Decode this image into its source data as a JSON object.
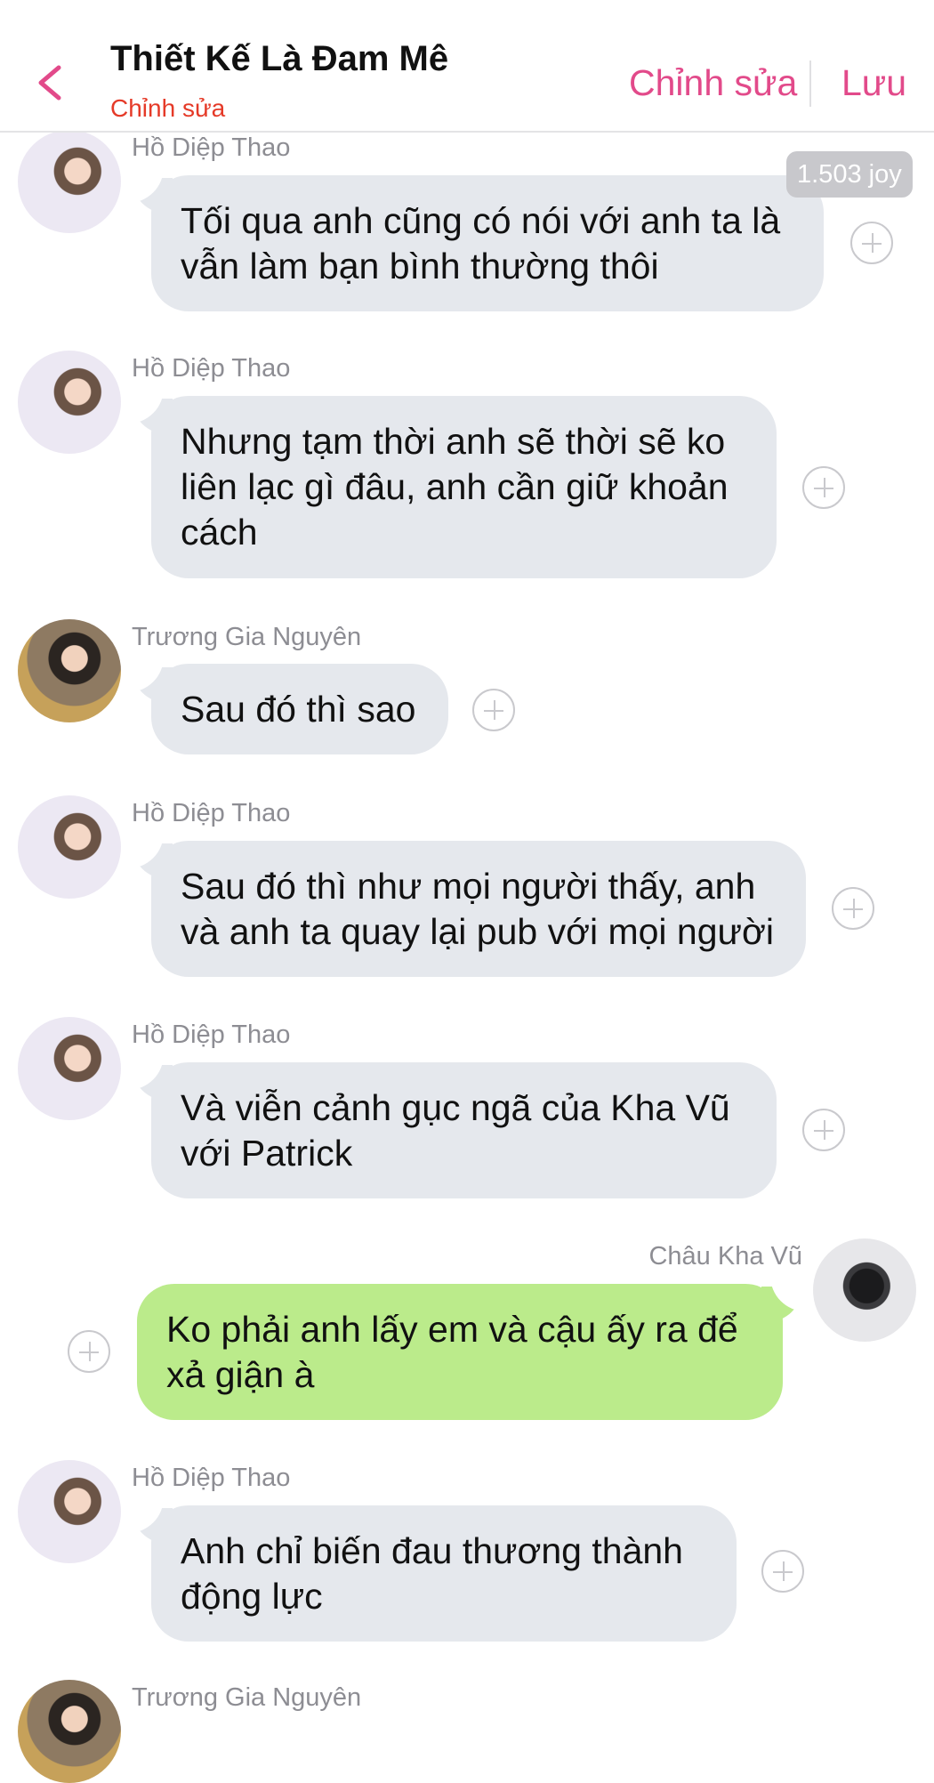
{
  "header": {
    "title": "Thiết Kế Là Đam Mê",
    "subtitle": "Chỉnh sửa",
    "edit_label": "Chỉnh sửa",
    "save_label": "Lưu",
    "accent_color": "#e24a8a"
  },
  "joy_badge": "1.503 joy",
  "messages": [
    {
      "sender": "Hồ Diệp Thao",
      "text": "Tối qua anh cũng có nói với anh ta là\nvẫn làm bạn bình thường thôi",
      "direction": "incoming"
    },
    {
      "sender": "Hồ Diệp Thao",
      "text": "Nhưng tạm thời anh sẽ thời sẽ ko\nliên lạc gì đâu, anh cần giữ khoản\ncách",
      "direction": "incoming"
    },
    {
      "sender": "Trương Gia Nguyên",
      "text": "Sau đó thì sao",
      "direction": "incoming"
    },
    {
      "sender": "Hồ Diệp Thao",
      "text": "Sau đó thì như mọi người thấy, anh\nvà anh ta quay lại pub với mọi người",
      "direction": "incoming"
    },
    {
      "sender": "Hồ Diệp Thao",
      "text": "Và viễn cảnh gục ngã của Kha Vũ\nvới Patrick",
      "direction": "incoming"
    },
    {
      "sender": "Châu Kha Vũ",
      "text": "Ko phải anh lấy em và cậu ấy ra để\nxả giận à",
      "direction": "outgoing"
    },
    {
      "sender": "Hồ Diệp Thao",
      "text": "Anh chỉ biến đau thương thành\nđộng lực",
      "direction": "incoming"
    },
    {
      "sender": "Trương Gia Nguyên",
      "text": "",
      "direction": "incoming"
    }
  ]
}
